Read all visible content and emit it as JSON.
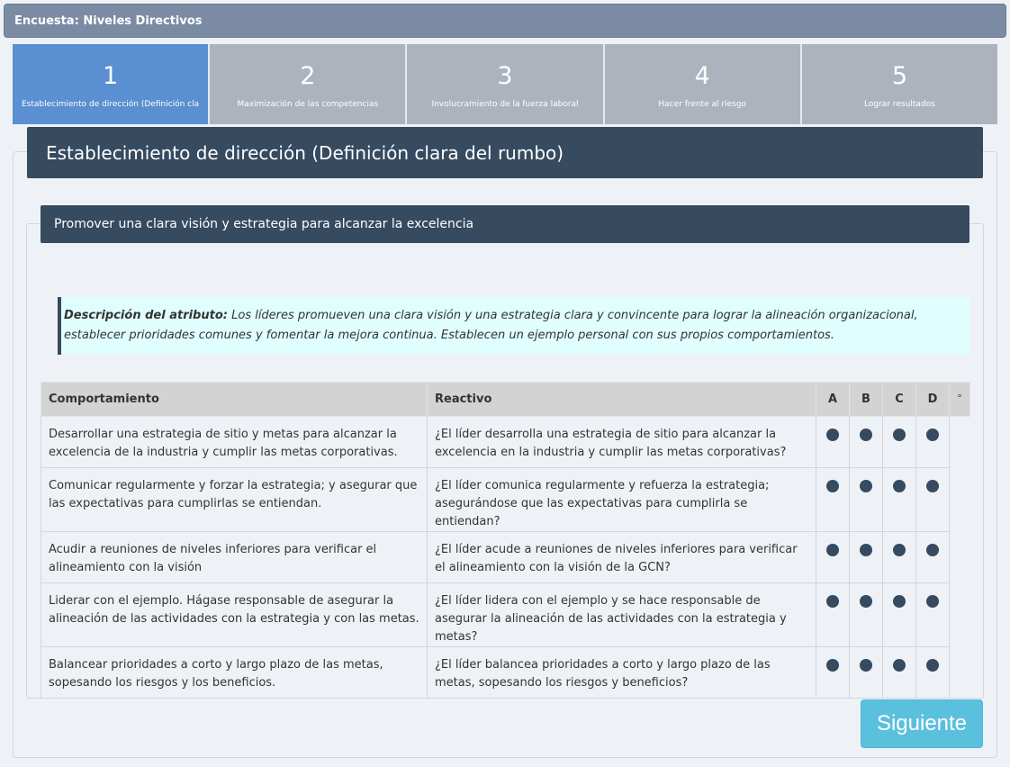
{
  "window": {
    "title": "Encuesta: Niveles Directivos"
  },
  "steps": [
    {
      "number": "1",
      "label": "Establecimiento de dirección (Definición cla",
      "active": true
    },
    {
      "number": "2",
      "label": "Maximización de las competencias",
      "active": false
    },
    {
      "number": "3",
      "label": "Involucramiento de la fuerza laboral",
      "active": false
    },
    {
      "number": "4",
      "label": "Hacer frente al riesgo",
      "active": false
    },
    {
      "number": "5",
      "label": "Lograr resultados",
      "active": false
    }
  ],
  "section": {
    "title": "Establecimiento de dirección (Definición clara del rumbo)"
  },
  "subsection": {
    "title": "Promover una clara visión y estrategia para alcanzar la excelencia"
  },
  "description": {
    "label": "Descripción del atributo:",
    "text": " Los líderes promueven una clara visión y una estrategia clara y convincente para lograr la alineación organizacional, establecer prioridades comunes y fomentar la mejora continua. Establecen un ejemplo personal con sus propios comportamientos."
  },
  "table": {
    "headers": {
      "behavior": "Comportamiento",
      "question": "Reactivo",
      "options": [
        "A",
        "B",
        "C",
        "D"
      ],
      "extra": "°"
    },
    "rows": [
      {
        "behavior": "Desarrollar una estrategia de sitio y metas para alcanzar la excelencia de la industria y cumplir las metas corporativas.",
        "question": "¿El líder desarrolla una estrategia de sitio para alcanzar la excelencia en la industria y cumplir las metas corporativas?"
      },
      {
        "behavior": "Comunicar regularmente y forzar la estrategia; y asegurar que las expectativas para cumplirlas se entiendan.",
        "question": "¿El líder comunica regularmente y refuerza la estrategia; asegurándose que las expectativas para cumplirla se entiendan?"
      },
      {
        "behavior": "Acudir a reuniones de niveles inferiores para verificar el alineamiento con la visión",
        "question": "¿El líder acude a reuniones de niveles inferiores para verificar el alineamiento con la visión de la GCN?"
      },
      {
        "behavior": "Liderar con el ejemplo. Hágase responsable de asegurar la alineación de las actividades con la estrategia y con las metas.",
        "question": "¿El líder lidera con el ejemplo y se hace responsable de asegurar la alineación de las actividades con la estrategia y metas?"
      },
      {
        "behavior": "Balancear prioridades a corto y largo plazo de las metas, sopesando los riesgos y los beneficios.",
        "question": "¿El líder balancea prioridades a corto y largo plazo de las metas, sopesando los riesgos y beneficios?"
      }
    ]
  },
  "actions": {
    "next_label": "Siguiente"
  },
  "colors": {
    "titlebar": "#7b8ba4",
    "step_active": "#5a8fd1",
    "step_inactive": "#adb3bd",
    "header_dark": "#364a60",
    "description_bg": "#e0fefe",
    "next_button": "#5bc0de"
  }
}
